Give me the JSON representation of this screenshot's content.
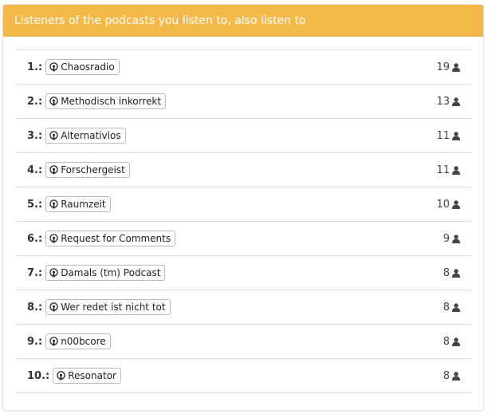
{
  "header": {
    "title": "Listeners of the podcasts you listen to, also listen to"
  },
  "icons": {
    "podcast": "podcast-icon",
    "listener": "user-icon"
  },
  "colors": {
    "header_bg": "#f5b94a",
    "header_text": "#ffffff"
  },
  "items": [
    {
      "rank": "1.:",
      "name": "Chaosradio",
      "count": "19"
    },
    {
      "rank": "2.:",
      "name": "Methodisch inkorrekt",
      "count": "13"
    },
    {
      "rank": "3.:",
      "name": "Alternativlos",
      "count": "11"
    },
    {
      "rank": "4.:",
      "name": "Forschergeist",
      "count": "11"
    },
    {
      "rank": "5.:",
      "name": "Raumzeit",
      "count": "10"
    },
    {
      "rank": "6.:",
      "name": "Request for Comments",
      "count": "9"
    },
    {
      "rank": "7.:",
      "name": "Damals (tm) Podcast",
      "count": "8"
    },
    {
      "rank": "8.:",
      "name": "Wer redet ist nicht tot",
      "count": "8"
    },
    {
      "rank": "9.:",
      "name": "n00bcore",
      "count": "8"
    },
    {
      "rank": "10.:",
      "name": "Resonator",
      "count": "8"
    }
  ]
}
